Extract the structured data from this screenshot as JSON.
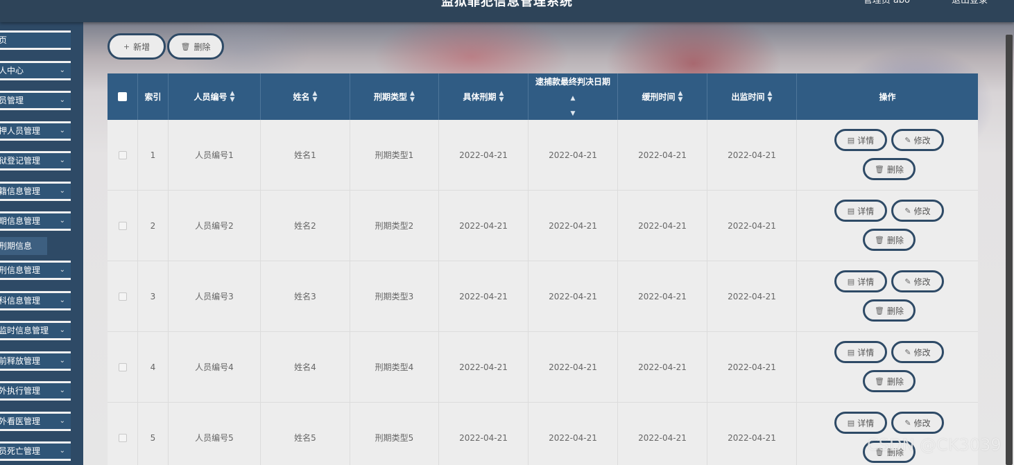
{
  "header": {
    "title": "监狱罪犯信息管理系统",
    "user_text": "管理员 abo",
    "logout_label": "退出登录"
  },
  "sidebar": {
    "items": [
      {
        "label": "页",
        "has_chevron": false
      },
      {
        "label": "人中心",
        "has_chevron": true
      },
      {
        "label": "员管理",
        "has_chevron": true
      },
      {
        "label": "押人员管理",
        "has_chevron": true
      },
      {
        "label": "狱登记管理",
        "has_chevron": true
      },
      {
        "label": "籍信息管理",
        "has_chevron": true
      },
      {
        "label": "期信息管理",
        "has_chevron": true
      },
      {
        "label": "刑信息管理",
        "has_chevron": true
      },
      {
        "label": "科信息管理",
        "has_chevron": true
      },
      {
        "label": "监时信息管理",
        "has_chevron": true
      },
      {
        "label": "前释放管理",
        "has_chevron": true
      },
      {
        "label": "外执行管理",
        "has_chevron": true
      },
      {
        "label": "外看医管理",
        "has_chevron": true
      },
      {
        "label": "员死亡管理",
        "has_chevron": true
      }
    ],
    "active_sub_item": "刑期信息"
  },
  "toolbar": {
    "add_label": "新增",
    "delete_label": "删除"
  },
  "table": {
    "columns": [
      {
        "key": "select",
        "label": ""
      },
      {
        "key": "index",
        "label": "索引",
        "sortable": false
      },
      {
        "key": "person_no",
        "label": "人员编号",
        "sortable": true
      },
      {
        "key": "name",
        "label": "姓名",
        "sortable": true
      },
      {
        "key": "sentence_type",
        "label": "刑期类型",
        "sortable": true
      },
      {
        "key": "term",
        "label": "具体刑期",
        "sortable": true
      },
      {
        "key": "arrest_date",
        "label": "逮捕款最终判决日期",
        "sortable": true
      },
      {
        "key": "reprieve_time",
        "label": "缓刑时间",
        "sortable": true
      },
      {
        "key": "release_time",
        "label": "出监时间",
        "sortable": true
      },
      {
        "key": "actions",
        "label": "操作",
        "sortable": false
      }
    ],
    "rows": [
      {
        "index": "1",
        "person_no": "人员编号1",
        "name": "姓名1",
        "sentence_type": "刑期类型1",
        "term": "2022-04-21",
        "arrest_date": "2022-04-21",
        "reprieve_time": "2022-04-21",
        "release_time": "2022-04-21"
      },
      {
        "index": "2",
        "person_no": "人员编号2",
        "name": "姓名2",
        "sentence_type": "刑期类型2",
        "term": "2022-04-21",
        "arrest_date": "2022-04-21",
        "reprieve_time": "2022-04-21",
        "release_time": "2022-04-21"
      },
      {
        "index": "3",
        "person_no": "人员编号3",
        "name": "姓名3",
        "sentence_type": "刑期类型3",
        "term": "2022-04-21",
        "arrest_date": "2022-04-21",
        "reprieve_time": "2022-04-21",
        "release_time": "2022-04-21"
      },
      {
        "index": "4",
        "person_no": "人员编号4",
        "name": "姓名4",
        "sentence_type": "刑期类型4",
        "term": "2022-04-21",
        "arrest_date": "2022-04-21",
        "reprieve_time": "2022-04-21",
        "release_time": "2022-04-21"
      },
      {
        "index": "5",
        "person_no": "人员编号5",
        "name": "姓名5",
        "sentence_type": "刑期类型5",
        "term": "2022-04-21",
        "arrest_date": "2022-04-21",
        "reprieve_time": "2022-04-21",
        "release_time": "2022-04-21"
      }
    ],
    "row_actions": {
      "detail_label": "详情",
      "edit_label": "修改",
      "delete_label": "删除"
    }
  },
  "icons": {
    "add": "plus-icon",
    "delete": "trash-icon",
    "detail": "document-icon",
    "edit": "pencil-icon",
    "chevron": "chevron-down-icon",
    "sort": "sort-icon"
  },
  "colors": {
    "header_bg": "#2e4459",
    "sidebar_bg": "#2f5577",
    "table_header_bg": "#305c84",
    "button_border": "#2e4a66"
  },
  "watermark": "CSDN @CK3039"
}
